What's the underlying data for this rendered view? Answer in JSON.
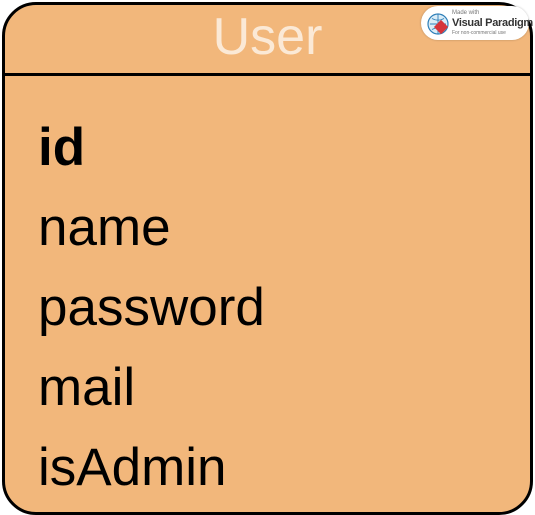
{
  "entity": {
    "name": "User",
    "attributes": [
      {
        "name": "id",
        "primary_key": true
      },
      {
        "name": "name",
        "primary_key": false
      },
      {
        "name": "password",
        "primary_key": false
      },
      {
        "name": "mail",
        "primary_key": false
      },
      {
        "name": "isAdmin",
        "primary_key": false
      }
    ]
  },
  "watermark": {
    "made_with": "Made with",
    "brand": "Visual Paradigm",
    "note": "For non-commercial use",
    "icon": "visual-paradigm-logo-icon"
  },
  "colors": {
    "entity_fill": "#f2b77b",
    "border": "#000000",
    "title_text": "#fbe9d6",
    "attribute_text": "#000000"
  }
}
